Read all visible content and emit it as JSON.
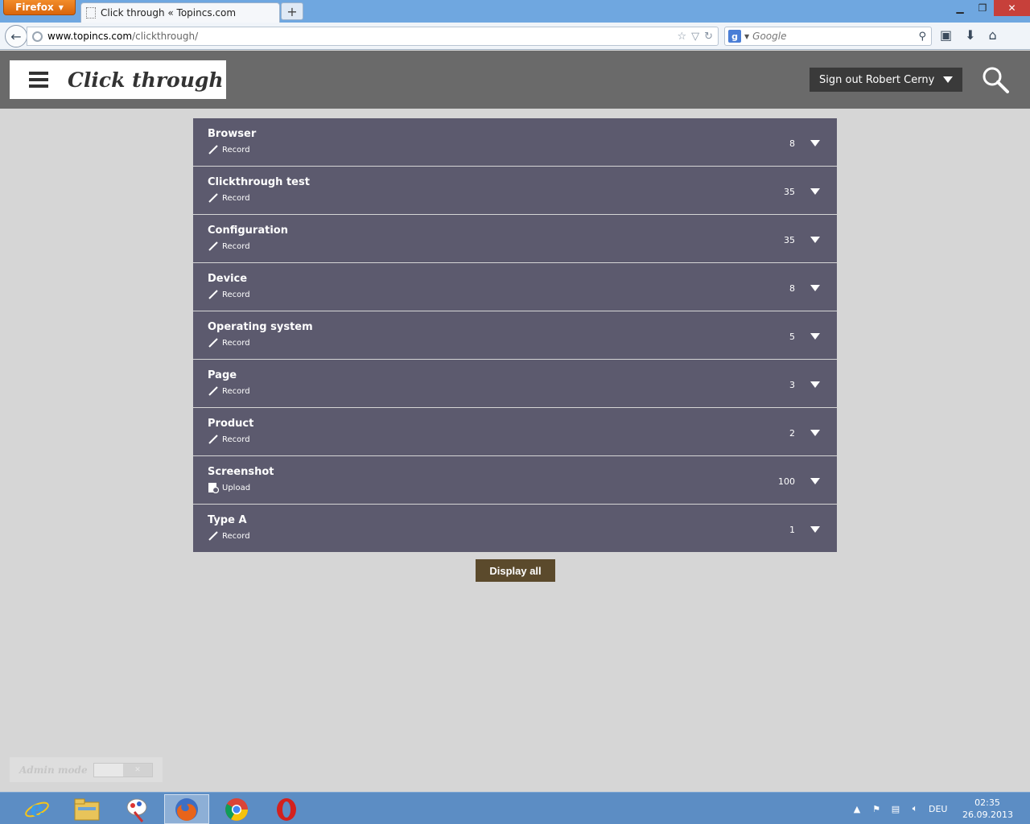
{
  "browser": {
    "menu_label": "Firefox",
    "tab_title": "Click through « Topincs.com",
    "new_tab": "+",
    "url_host": "www.topincs.com",
    "url_path": "/clickthrough/",
    "search_engine": "g",
    "search_placeholder": "Google"
  },
  "header": {
    "title": "Click through",
    "signout_label": "Sign out Robert Cerny"
  },
  "rows": [
    {
      "title": "Browser",
      "action": "Record",
      "action_icon": "pencil-icon",
      "count": "8"
    },
    {
      "title": "Clickthrough test",
      "action": "Record",
      "action_icon": "pencil-icon",
      "count": "35"
    },
    {
      "title": "Configuration",
      "action": "Record",
      "action_icon": "pencil-icon",
      "count": "35"
    },
    {
      "title": "Device",
      "action": "Record",
      "action_icon": "pencil-icon",
      "count": "8"
    },
    {
      "title": "Operating system",
      "action": "Record",
      "action_icon": "pencil-icon",
      "count": "5"
    },
    {
      "title": "Page",
      "action": "Record",
      "action_icon": "pencil-icon",
      "count": "3"
    },
    {
      "title": "Product",
      "action": "Record",
      "action_icon": "pencil-icon",
      "count": "2"
    },
    {
      "title": "Screenshot",
      "action": "Upload",
      "action_icon": "upload-icon",
      "count": "100"
    },
    {
      "title": "Type A",
      "action": "Record",
      "action_icon": "pencil-icon",
      "count": "1"
    }
  ],
  "display_all_label": "Display all",
  "admin_mode_label": "Admin mode",
  "taskbar": {
    "language": "DEU",
    "time": "02:35",
    "date": "26.09.2013"
  },
  "colors": {
    "row_bg": "#5c5a6e",
    "header_bg": "#6a6a6a",
    "display_all_bg": "#5b4a2c",
    "page_bg": "#d6d6d6"
  }
}
